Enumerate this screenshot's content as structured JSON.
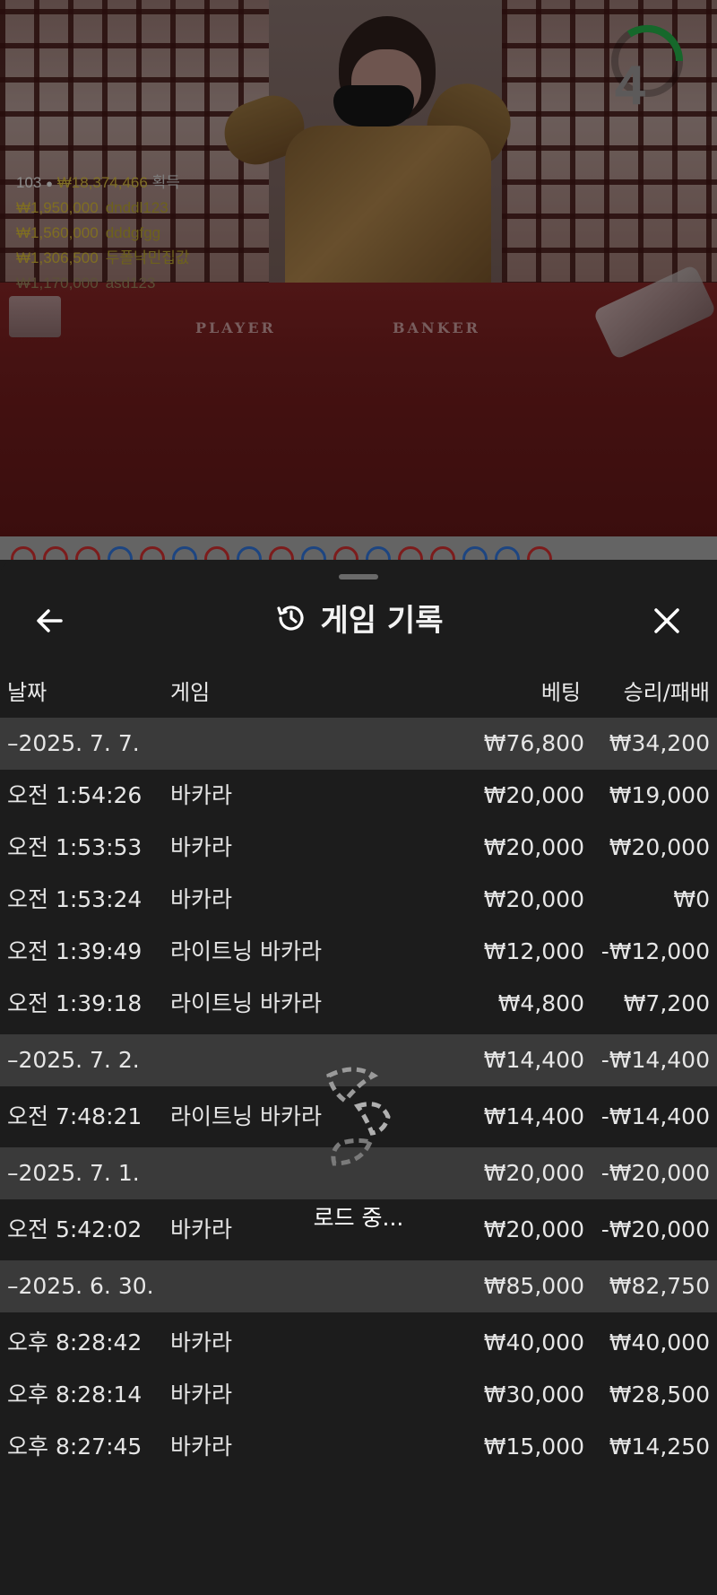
{
  "video": {
    "timer_value": "4",
    "table_labels": {
      "player": "PLAYER",
      "banker": "BANKER"
    },
    "leaderboard": {
      "count": "103",
      "total": "₩18,374,466",
      "total_suffix": "획득",
      "entries": [
        {
          "amount": "₩1,950,000",
          "name": "dnddl123"
        },
        {
          "amount": "₩1,560,000",
          "name": "dddgfgg"
        },
        {
          "amount": "₩1,306,500",
          "name": "두폴낙민집값"
        },
        {
          "amount": "₩1,170,000",
          "name": "asd123"
        }
      ]
    }
  },
  "sheet": {
    "title": "게임 기록",
    "columns": {
      "date": "날짜",
      "game": "게임",
      "bet": "베팅",
      "result": "승리/패배"
    },
    "loading_text": "로드 중...",
    "rows": [
      {
        "type": "date",
        "label": "–2025. 7. 7.",
        "bet": "₩76,800",
        "result": "₩34,200"
      },
      {
        "type": "item",
        "time": "오전 1:54:26",
        "game": "바카라",
        "bet": "₩20,000",
        "result": "₩19,000"
      },
      {
        "type": "item",
        "time": "오전 1:53:53",
        "game": "바카라",
        "bet": "₩20,000",
        "result": "₩20,000"
      },
      {
        "type": "item",
        "time": "오전 1:53:24",
        "game": "바카라",
        "bet": "₩20,000",
        "result": "₩0"
      },
      {
        "type": "item",
        "time": "오전 1:39:49",
        "game": "라이트닝 바카라",
        "bet": "₩12,000",
        "result": "-₩12,000"
      },
      {
        "type": "item",
        "time": "오전 1:39:18",
        "game": "라이트닝 바카라",
        "bet": "₩4,800",
        "result": "₩7,200"
      },
      {
        "type": "date",
        "label": "–2025. 7. 2.",
        "bet": "₩14,400",
        "result": "-₩14,400"
      },
      {
        "type": "item",
        "time": "오전 7:48:21",
        "game": "라이트닝 바카라",
        "bet": "₩14,400",
        "result": "-₩14,400"
      },
      {
        "type": "date",
        "label": "–2025. 7. 1.",
        "bet": "₩20,000",
        "result": "-₩20,000"
      },
      {
        "type": "item",
        "time": "오전 5:42:02",
        "game": "바카라",
        "bet": "₩20,000",
        "result": "-₩20,000"
      },
      {
        "type": "date",
        "label": "–2025. 6. 30.",
        "bet": "₩85,000",
        "result": "₩82,750"
      },
      {
        "type": "item",
        "time": "오후 8:28:42",
        "game": "바카라",
        "bet": "₩40,000",
        "result": "₩40,000"
      },
      {
        "type": "item",
        "time": "오후 8:28:14",
        "game": "바카라",
        "bet": "₩30,000",
        "result": "₩28,500"
      },
      {
        "type": "item",
        "time": "오후 8:27:45",
        "game": "바카라",
        "bet": "₩15,000",
        "result": "₩14,250"
      }
    ]
  }
}
